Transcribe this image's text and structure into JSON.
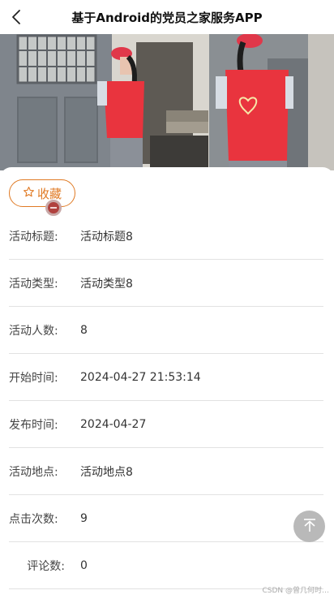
{
  "header": {
    "title": "基于Android的党员之家服务APP",
    "back_icon": "chevron-left-icon"
  },
  "favorite": {
    "label": "收藏",
    "icon": "star-outline-icon",
    "accent_color": "#e07a24"
  },
  "details": [
    {
      "label": "活动标题:",
      "value": "活动标题8"
    },
    {
      "label": "活动类型:",
      "value": "活动类型8"
    },
    {
      "label": "活动人数:",
      "value": "8"
    },
    {
      "label": "开始时间:",
      "value": "2024-04-27 21:53:14"
    },
    {
      "label": "发布时间:",
      "value": "2024-04-27"
    },
    {
      "label": "活动地点:",
      "value": "活动地点8"
    },
    {
      "label": "点击次数:",
      "value": "9"
    },
    {
      "label": "评论数:",
      "value": "0"
    }
  ],
  "back_to_top_icon": "arrow-up-to-top-icon",
  "watermark": "CSDN @曾几何时…"
}
